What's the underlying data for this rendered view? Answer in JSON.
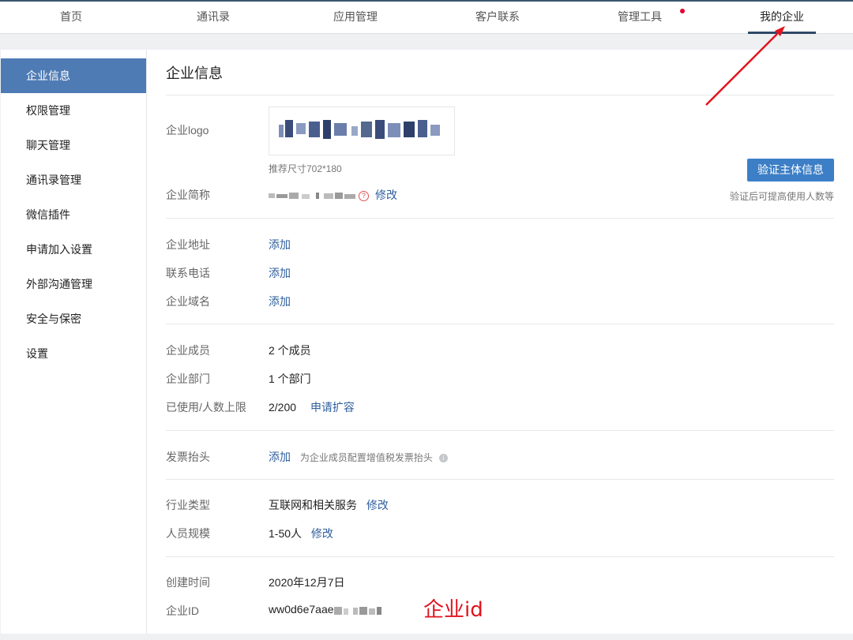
{
  "nav": {
    "tabs": [
      {
        "label": "首页"
      },
      {
        "label": "通讯录"
      },
      {
        "label": "应用管理"
      },
      {
        "label": "客户联系"
      },
      {
        "label": "管理工具"
      },
      {
        "label": "我的企业"
      }
    ],
    "active_index": 5,
    "notification_dot_on": "管理工具"
  },
  "sidebar": {
    "items": [
      {
        "label": "企业信息"
      },
      {
        "label": "权限管理"
      },
      {
        "label": "聊天管理"
      },
      {
        "label": "通讯录管理"
      },
      {
        "label": "微信插件"
      },
      {
        "label": "申请加入设置"
      },
      {
        "label": "外部沟通管理"
      },
      {
        "label": "安全与保密"
      },
      {
        "label": "设置"
      }
    ],
    "active_index": 0
  },
  "main": {
    "title": "企业信息",
    "logo": {
      "label": "企业logo",
      "hint": "推荐尺寸702*180"
    },
    "short_name": {
      "label": "企业简称",
      "edit": "修改"
    },
    "verify": {
      "button": "验证主体信息",
      "hint": "验证后可提高使用人数等"
    },
    "address": {
      "label": "企业地址",
      "action": "添加"
    },
    "phone": {
      "label": "联系电话",
      "action": "添加"
    },
    "domain": {
      "label": "企业域名",
      "action": "添加"
    },
    "members": {
      "label": "企业成员",
      "value": "2 个成员"
    },
    "departments": {
      "label": "企业部门",
      "value": "1 个部门"
    },
    "usage": {
      "label": "已使用/人数上限",
      "value": "2/200",
      "action": "申请扩容"
    },
    "invoice": {
      "label": "发票抬头",
      "action": "添加",
      "hint": "为企业成员配置增值税发票抬头"
    },
    "industry": {
      "label": "行业类型",
      "value": "互联网和相关服务",
      "edit": "修改"
    },
    "scale": {
      "label": "人员规模",
      "value": "1-50人",
      "edit": "修改"
    },
    "created": {
      "label": "创建时间",
      "value": "2020年12月7日"
    },
    "corp_id": {
      "label": "企业ID",
      "value": "ww0d6e7aae"
    }
  },
  "annotation": {
    "text": "企业id",
    "color": "#e0141e"
  },
  "colors": {
    "accent": "#4f7bb5",
    "button": "#3d7fc6",
    "link": "#2f5f9e",
    "nav_active": "#2e4a66"
  }
}
